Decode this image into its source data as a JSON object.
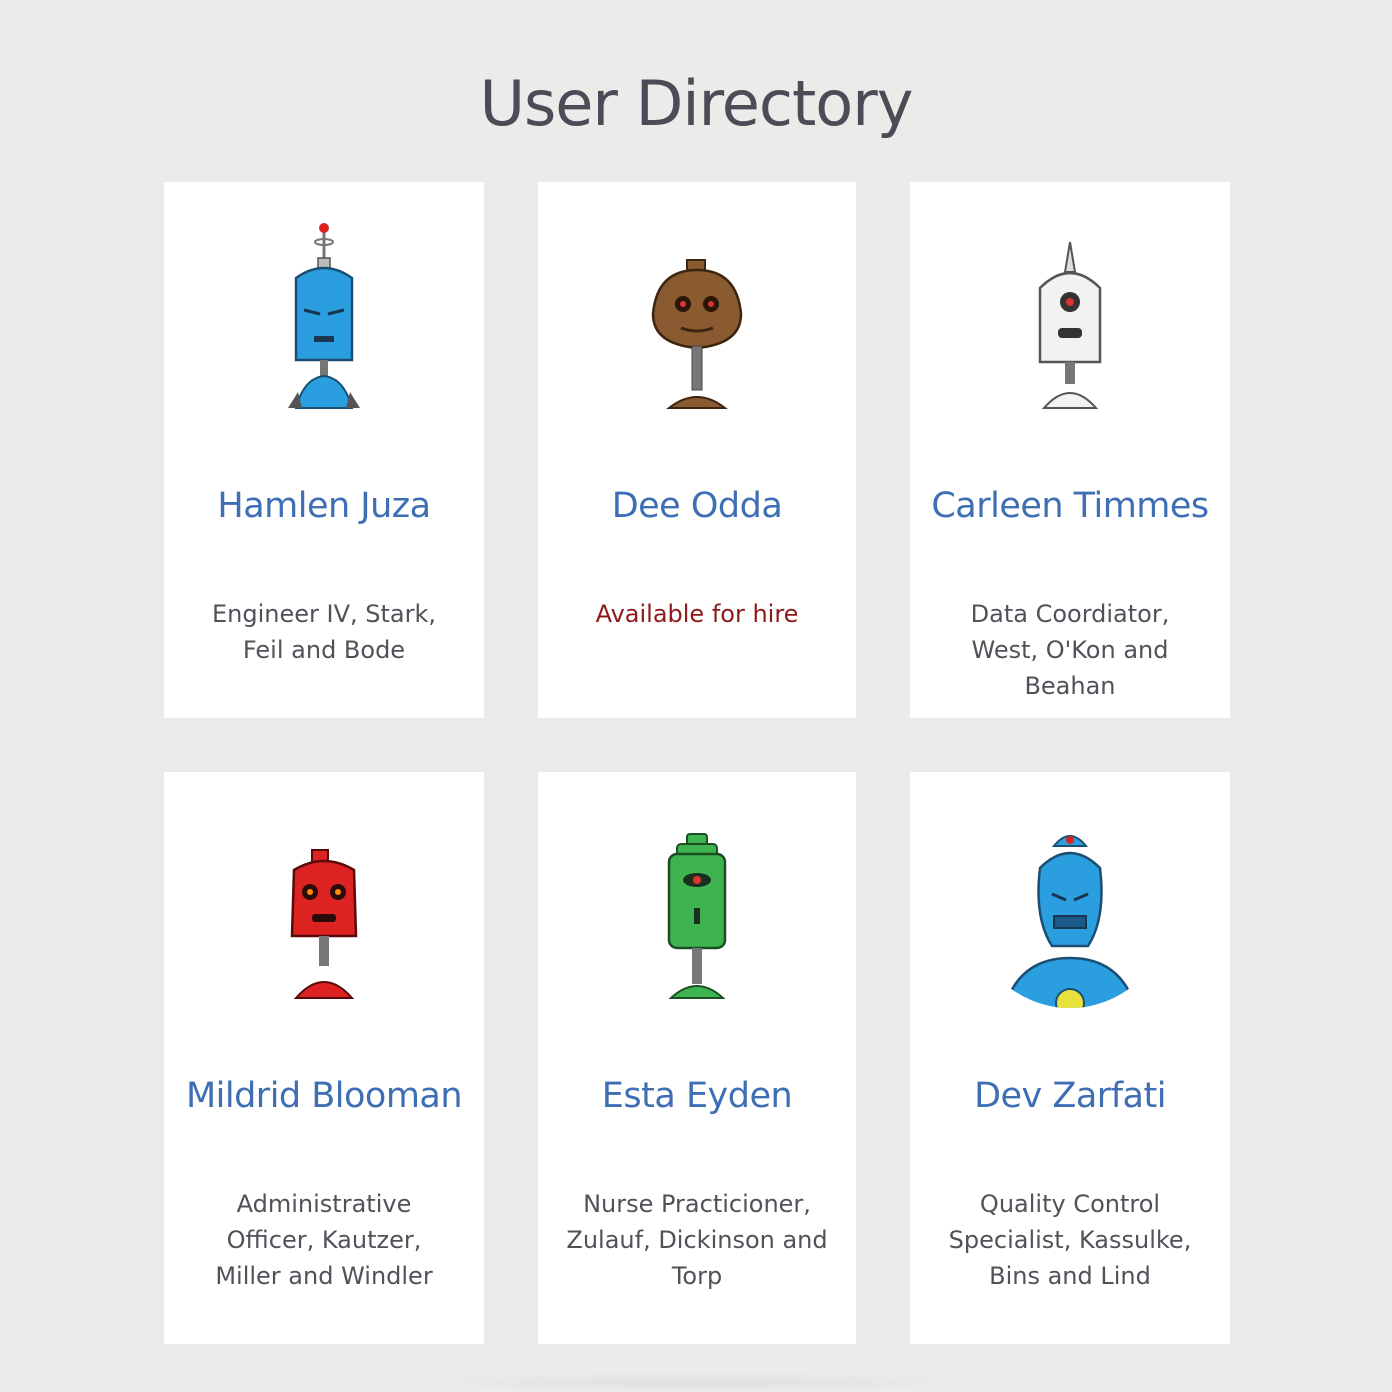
{
  "page": {
    "title": "User Directory"
  },
  "colors": {
    "background": "#ecebea",
    "card": "#ffffff",
    "name": "#3e6fb5",
    "role": "#4f5359",
    "hire": "#8b1a1a"
  },
  "users": [
    {
      "name": "Hamlen Juza",
      "role": "Engineer IV, Stark, Feil and Bode",
      "avatar": "blue-antenna-robot-icon"
    },
    {
      "name": "Dee Odda",
      "role": "Available for hire",
      "avatar": "brown-egg-robot-icon"
    },
    {
      "name": "Carleen Timmes",
      "role": "Data Coordiator, West, O'Kon and Beahan",
      "avatar": "white-cyclops-robot-icon"
    },
    {
      "name": "Mildrid Blooman",
      "role": "Administrative Officer, Kautzer, Miller and Windler",
      "avatar": "red-box-robot-icon"
    },
    {
      "name": "Esta Eyden",
      "role": "Nurse Practicioner, Zulauf, Dickinson and Torp",
      "avatar": "green-can-robot-icon"
    },
    {
      "name": "Dev Zarfati",
      "role": "Quality Control Specialist, Kassulke, Bins and Lind",
      "avatar": "blue-dome-robot-icon"
    }
  ]
}
